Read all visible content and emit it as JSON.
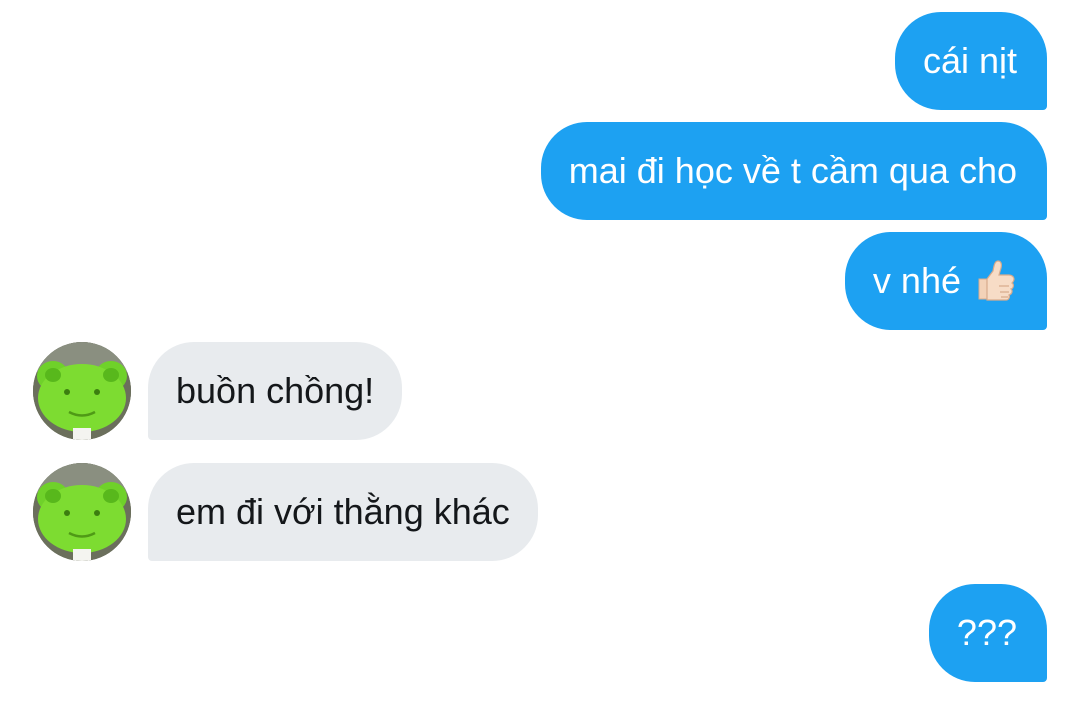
{
  "conversation": {
    "messages": [
      {
        "sender": "me",
        "text": "cái nịt"
      },
      {
        "sender": "me",
        "text": "mai đi học về t cầm qua cho"
      },
      {
        "sender": "me",
        "text": "v nhé",
        "emoji": "thumbs-up-icon"
      },
      {
        "sender": "other",
        "text": "buồn chồng!"
      },
      {
        "sender": "other",
        "text": "em đi với thằng khác"
      },
      {
        "sender": "me",
        "text": "???"
      }
    ]
  },
  "colors": {
    "outgoing_bubble": "#1da1f2",
    "incoming_bubble": "#e8ebee",
    "outgoing_text": "#ffffff",
    "incoming_text": "#14171a"
  },
  "avatar": {
    "description_icon": "green-frog-plush-avatar"
  }
}
